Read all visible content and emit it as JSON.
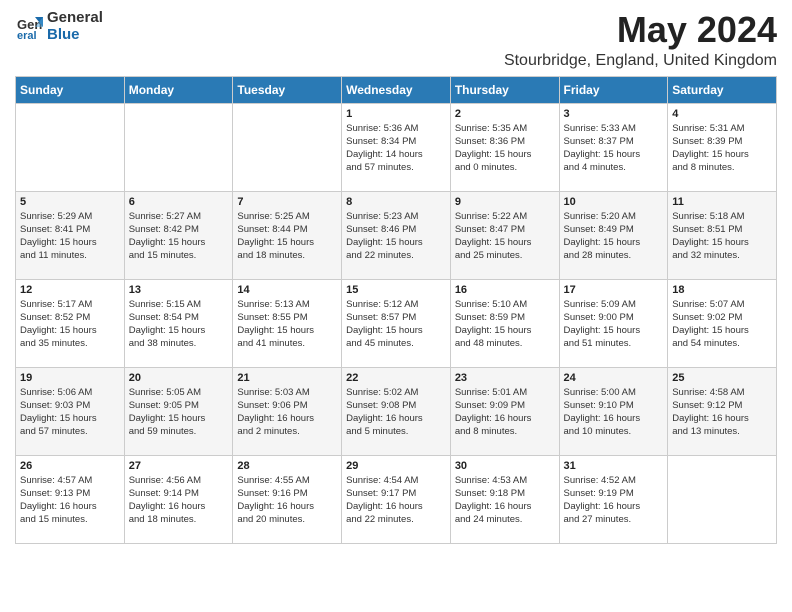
{
  "header": {
    "logo_general": "General",
    "logo_blue": "Blue",
    "month_year": "May 2024",
    "location": "Stourbridge, England, United Kingdom"
  },
  "weekdays": [
    "Sunday",
    "Monday",
    "Tuesday",
    "Wednesday",
    "Thursday",
    "Friday",
    "Saturday"
  ],
  "weeks": [
    [
      {
        "day": "",
        "info": ""
      },
      {
        "day": "",
        "info": ""
      },
      {
        "day": "",
        "info": ""
      },
      {
        "day": "1",
        "info": "Sunrise: 5:36 AM\nSunset: 8:34 PM\nDaylight: 14 hours\nand 57 minutes."
      },
      {
        "day": "2",
        "info": "Sunrise: 5:35 AM\nSunset: 8:36 PM\nDaylight: 15 hours\nand 0 minutes."
      },
      {
        "day": "3",
        "info": "Sunrise: 5:33 AM\nSunset: 8:37 PM\nDaylight: 15 hours\nand 4 minutes."
      },
      {
        "day": "4",
        "info": "Sunrise: 5:31 AM\nSunset: 8:39 PM\nDaylight: 15 hours\nand 8 minutes."
      }
    ],
    [
      {
        "day": "5",
        "info": "Sunrise: 5:29 AM\nSunset: 8:41 PM\nDaylight: 15 hours\nand 11 minutes."
      },
      {
        "day": "6",
        "info": "Sunrise: 5:27 AM\nSunset: 8:42 PM\nDaylight: 15 hours\nand 15 minutes."
      },
      {
        "day": "7",
        "info": "Sunrise: 5:25 AM\nSunset: 8:44 PM\nDaylight: 15 hours\nand 18 minutes."
      },
      {
        "day": "8",
        "info": "Sunrise: 5:23 AM\nSunset: 8:46 PM\nDaylight: 15 hours\nand 22 minutes."
      },
      {
        "day": "9",
        "info": "Sunrise: 5:22 AM\nSunset: 8:47 PM\nDaylight: 15 hours\nand 25 minutes."
      },
      {
        "day": "10",
        "info": "Sunrise: 5:20 AM\nSunset: 8:49 PM\nDaylight: 15 hours\nand 28 minutes."
      },
      {
        "day": "11",
        "info": "Sunrise: 5:18 AM\nSunset: 8:51 PM\nDaylight: 15 hours\nand 32 minutes."
      }
    ],
    [
      {
        "day": "12",
        "info": "Sunrise: 5:17 AM\nSunset: 8:52 PM\nDaylight: 15 hours\nand 35 minutes."
      },
      {
        "day": "13",
        "info": "Sunrise: 5:15 AM\nSunset: 8:54 PM\nDaylight: 15 hours\nand 38 minutes."
      },
      {
        "day": "14",
        "info": "Sunrise: 5:13 AM\nSunset: 8:55 PM\nDaylight: 15 hours\nand 41 minutes."
      },
      {
        "day": "15",
        "info": "Sunrise: 5:12 AM\nSunset: 8:57 PM\nDaylight: 15 hours\nand 45 minutes."
      },
      {
        "day": "16",
        "info": "Sunrise: 5:10 AM\nSunset: 8:59 PM\nDaylight: 15 hours\nand 48 minutes."
      },
      {
        "day": "17",
        "info": "Sunrise: 5:09 AM\nSunset: 9:00 PM\nDaylight: 15 hours\nand 51 minutes."
      },
      {
        "day": "18",
        "info": "Sunrise: 5:07 AM\nSunset: 9:02 PM\nDaylight: 15 hours\nand 54 minutes."
      }
    ],
    [
      {
        "day": "19",
        "info": "Sunrise: 5:06 AM\nSunset: 9:03 PM\nDaylight: 15 hours\nand 57 minutes."
      },
      {
        "day": "20",
        "info": "Sunrise: 5:05 AM\nSunset: 9:05 PM\nDaylight: 15 hours\nand 59 minutes."
      },
      {
        "day": "21",
        "info": "Sunrise: 5:03 AM\nSunset: 9:06 PM\nDaylight: 16 hours\nand 2 minutes."
      },
      {
        "day": "22",
        "info": "Sunrise: 5:02 AM\nSunset: 9:08 PM\nDaylight: 16 hours\nand 5 minutes."
      },
      {
        "day": "23",
        "info": "Sunrise: 5:01 AM\nSunset: 9:09 PM\nDaylight: 16 hours\nand 8 minutes."
      },
      {
        "day": "24",
        "info": "Sunrise: 5:00 AM\nSunset: 9:10 PM\nDaylight: 16 hours\nand 10 minutes."
      },
      {
        "day": "25",
        "info": "Sunrise: 4:58 AM\nSunset: 9:12 PM\nDaylight: 16 hours\nand 13 minutes."
      }
    ],
    [
      {
        "day": "26",
        "info": "Sunrise: 4:57 AM\nSunset: 9:13 PM\nDaylight: 16 hours\nand 15 minutes."
      },
      {
        "day": "27",
        "info": "Sunrise: 4:56 AM\nSunset: 9:14 PM\nDaylight: 16 hours\nand 18 minutes."
      },
      {
        "day": "28",
        "info": "Sunrise: 4:55 AM\nSunset: 9:16 PM\nDaylight: 16 hours\nand 20 minutes."
      },
      {
        "day": "29",
        "info": "Sunrise: 4:54 AM\nSunset: 9:17 PM\nDaylight: 16 hours\nand 22 minutes."
      },
      {
        "day": "30",
        "info": "Sunrise: 4:53 AM\nSunset: 9:18 PM\nDaylight: 16 hours\nand 24 minutes."
      },
      {
        "day": "31",
        "info": "Sunrise: 4:52 AM\nSunset: 9:19 PM\nDaylight: 16 hours\nand 27 minutes."
      },
      {
        "day": "",
        "info": ""
      }
    ]
  ]
}
